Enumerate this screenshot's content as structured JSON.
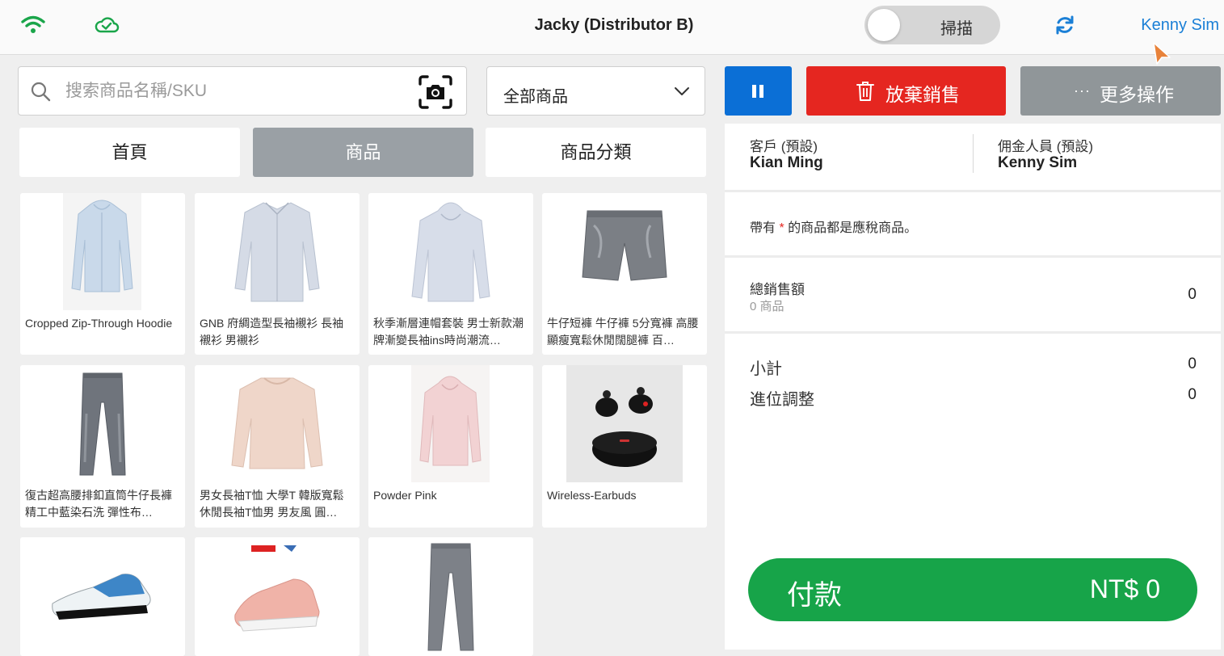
{
  "header": {
    "title": "Jacky (Distributor B)",
    "scan_label": "掃描",
    "user_name": "Kenny Sim",
    "colors": {
      "wifi": "#1aa54a",
      "cloud": "#1aa54a",
      "sync": "#1a7fd6",
      "user": "#1a7fd6"
    },
    "icons": [
      "wifi-icon",
      "cloud-check-icon",
      "sync-icon",
      "cursor-icon"
    ]
  },
  "search": {
    "placeholder": "搜索商品名稱/SKU",
    "value": ""
  },
  "filter": {
    "selected": "全部商品"
  },
  "tabs": [
    {
      "label": "首頁",
      "active": false
    },
    {
      "label": "商品",
      "active": true
    },
    {
      "label": "商品分類",
      "active": false
    }
  ],
  "products": [
    {
      "name": "Cropped Zip-Through Hoodie"
    },
    {
      "name": "GNB 府綢造型長袖襯衫 長袖襯衫 男襯衫"
    },
    {
      "name": "秋季漸層連帽套裝 男士新款潮牌漸變長袖ins時尚潮流…"
    },
    {
      "name": "牛仔短褲 牛仔褲 5分寬褲 高腰顯瘦寬鬆休閒闊腿褲 百…"
    },
    {
      "name": "復古超高腰排釦直筒牛仔長褲 精工中藍染石洗 彈性布…"
    },
    {
      "name": "男女長袖T恤 大學T 韓版寬鬆休閒長袖T恤男 男友風 圓…"
    },
    {
      "name": "Powder Pink"
    },
    {
      "name": "Wireless-Earbuds"
    },
    {
      "name": ""
    },
    {
      "name": ""
    },
    {
      "name": ""
    }
  ],
  "actions": {
    "abandon_label": "放棄銷售",
    "more_label": "更多操作",
    "more_dots": "···",
    "colors": {
      "pause": "#0b6fd6",
      "abandon": "#e52620",
      "more": "#909699"
    }
  },
  "order": {
    "customer_caption": "客戶 (預設)",
    "customer_name": "Kian Ming",
    "commission_caption": "佣金人員 (預設)",
    "commission_name": "Kenny Sim",
    "tax_note_prefix": "帶有",
    "tax_note_star": "*",
    "tax_note_suffix": "的商品都是應稅商品。",
    "total_caption": "總銷售額",
    "total_items": "0 商品",
    "total_value": "0",
    "subtotal_caption": "小計",
    "subtotal_value": "0",
    "rounding_caption": "進位調整",
    "rounding_value": "0"
  },
  "payment": {
    "label": "付款",
    "amount": "NT$ 0",
    "color": "#17a449"
  }
}
